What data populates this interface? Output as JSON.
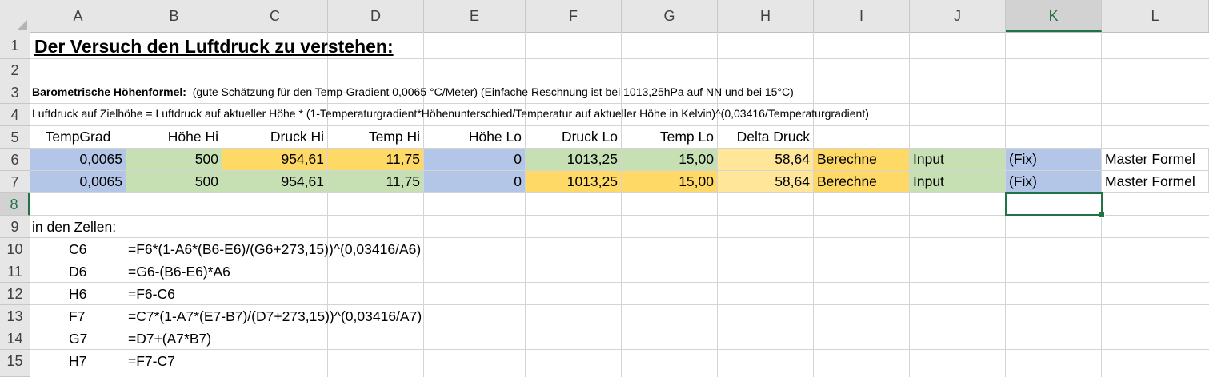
{
  "columns": [
    "A",
    "B",
    "C",
    "D",
    "E",
    "F",
    "G",
    "H",
    "I",
    "J",
    "K",
    "L"
  ],
  "rows": [
    "1",
    "2",
    "3",
    "4",
    "5",
    "6",
    "7",
    "8",
    "9",
    "10",
    "11",
    "12",
    "13",
    "14",
    "15"
  ],
  "selected_cell": "K8",
  "title": "Der Versuch den Luftdruck zu verstehen:",
  "formula_desc": {
    "label": "Barometrische Höhenformel:",
    "text": "(gute Schätzung für den Temp-Gradient 0,0065 °C/Meter) (Einfache Reschnung ist bei 1013,25hPa auf NN und bei 15°C)"
  },
  "formula_line": "Luftdruck auf Zielhöhe = Luftdruck auf aktueller Höhe * (1-Temperaturgradient*Höhenunterschied/Temperatur auf aktueller Höhe in Kelvin)^(0,03416/Temperaturgradient)",
  "headers": [
    "TempGrad",
    "Höhe Hi",
    "Druck Hi",
    "Temp Hi",
    "Höhe Lo",
    "Druck Lo",
    "Temp Lo",
    "Delta Druck"
  ],
  "data_rows": [
    {
      "values": [
        "0,0065",
        "500",
        "954,61",
        "11,75",
        "0",
        "1013,25",
        "15,00",
        "58,64"
      ],
      "i": "Berechne",
      "j": "Input",
      "k": "(Fix)",
      "l": "Master Formel"
    },
    {
      "values": [
        "0,0065",
        "500",
        "954,61",
        "11,75",
        "0",
        "1013,25",
        "15,00",
        "58,64"
      ],
      "i": "Berechne",
      "j": "Input",
      "k": "(Fix)",
      "l": "Master Formel"
    }
  ],
  "cells_label": "in den Zellen:",
  "formulas": [
    {
      "cell": "C6",
      "formula": "=F6*(1-A6*(B6-E6)/(G6+273,15))^(0,03416/A6)"
    },
    {
      "cell": "D6",
      "formula": "=G6-(B6-E6)*A6"
    },
    {
      "cell": "H6",
      "formula": "=F6-C6"
    },
    {
      "cell": "F7",
      "formula": "=C7*(1-A7*(E7-B7)/(D7+273,15))^(0,03416/A7)"
    },
    {
      "cell": "G7",
      "formula": "=D7+(A7*B7)"
    },
    {
      "cell": "H7",
      "formula": "=F7-C7"
    }
  ],
  "colors": {
    "blue": "#b4c6e7",
    "green": "#c6e0b4",
    "orange": "#ffd966",
    "light_yellow": "#ffe699",
    "select": "#217346"
  }
}
